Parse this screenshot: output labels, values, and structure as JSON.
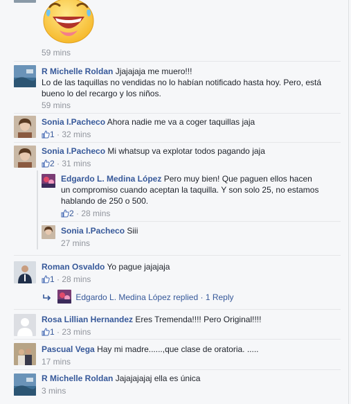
{
  "colors": {
    "link": "#365899",
    "meta": "#90949c",
    "text": "#1d2129",
    "bg": "#f6f7f9"
  },
  "comments": {
    "c0": {
      "time": "59 mins",
      "emoji": "laughing-face-icon"
    },
    "c1": {
      "name": "R Michelle Roldan",
      "line1": "Jjajajaja me muero!!!",
      "line2": "Lo de las taquillas no vendidas no lo habían notificado hasta hoy. Pero, está",
      "line3": "bueno lo del recargo y los niños.",
      "time": "59 mins"
    },
    "c2": {
      "name": "Sonia I.Pacheco",
      "text": "Ahora nadie me va a coger taquillas jaja",
      "likes": "1",
      "time": "· 32 mins"
    },
    "c3": {
      "name": "Sonia I.Pacheco",
      "text": "Mi whatsup va explotar todos pagando jaja",
      "likes": "2",
      "time": "· 31 mins"
    },
    "r1": {
      "name": "Edgardo L. Medina López",
      "line1": "Pero muy bien! Que paguen ellos hacen",
      "line2": "un compromiso cuando aceptan la taquilla. Y son solo 25, no estamos",
      "line3": "hablando de 250 o 500.",
      "likes": "2",
      "time": "· 28 mins"
    },
    "r2": {
      "name": "Sonia I.Pacheco",
      "text": "Siii",
      "time": "27 mins"
    },
    "c4": {
      "name": "Roman Osvaldo",
      "text": "Yo pague jajajaja",
      "likes": "1",
      "time": "· 28 mins",
      "replied_name": "Edgardo L. Medina López",
      "replied_text": "replied ·",
      "reply_count": "1 Reply"
    },
    "c5": {
      "name": "Rosa Lillian Hernandez",
      "text": "Eres Tremenda!!!! Pero Original!!!!",
      "likes": "1",
      "time": "· 23 mins"
    },
    "c6": {
      "name": "Pascual Vega",
      "text": "Hay mi madre......,que clase de oratoria. .....",
      "time": "17 mins"
    },
    "c7": {
      "name": "R Michelle Roldan",
      "text": "Jajajajajaj ella es única",
      "time": "3 mins"
    }
  }
}
